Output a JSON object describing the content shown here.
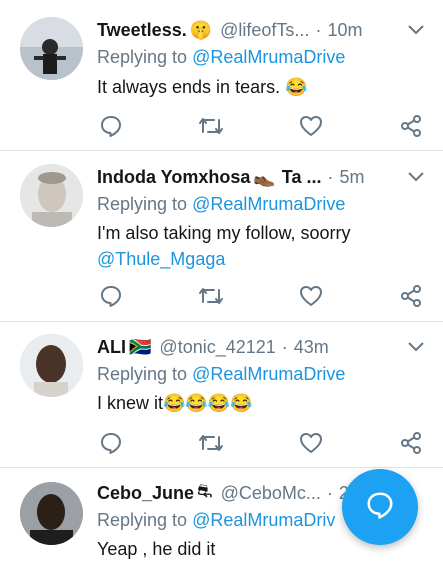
{
  "accent": "#1da1f2",
  "mention_color": "#1b95e0",
  "muted_color": "#657786",
  "tweets": [
    {
      "name": "Tweetless.",
      "emoji": "🤫",
      "handle": "@lifeofTs...",
      "separator": "·",
      "time": "10m",
      "reply_prefix": "Replying to",
      "reply_to": "@RealMrumaDrive",
      "text": "It always ends in tears. 😂",
      "text_link": ""
    },
    {
      "name": "Indoda Yomxhosa",
      "emoji": "👞",
      "name_suffix": "Ta ...",
      "handle": "",
      "separator": "·",
      "time": "5m",
      "reply_prefix": "Replying to",
      "reply_to": "@RealMrumaDrive",
      "text": "I'm also taking my follow, soorry",
      "text_link": "@Thule_Mgaga"
    },
    {
      "name": "ALI",
      "emoji": "🇿🇦",
      "handle": "@tonic_42121",
      "separator": "·",
      "time": "43m",
      "reply_prefix": "Replying to",
      "reply_to": "@RealMrumaDrive",
      "text": "I knew it😂😂😂😂",
      "text_link": ""
    },
    {
      "name": "Cebo_June",
      "emoji": "⛐",
      "handle": "@CeboMc...",
      "separator": "·",
      "time": "2",
      "reply_prefix": "Replying to",
      "reply_to": "@RealMrumaDriv",
      "text": "Yeap , he did it",
      "text_link": ""
    }
  ],
  "icons": {
    "reply": "reply-icon",
    "retweet": "retweet-icon",
    "like": "heart-icon",
    "share": "share-icon",
    "menu": "chevron-down-icon",
    "compose": "compose-reply-icon"
  }
}
